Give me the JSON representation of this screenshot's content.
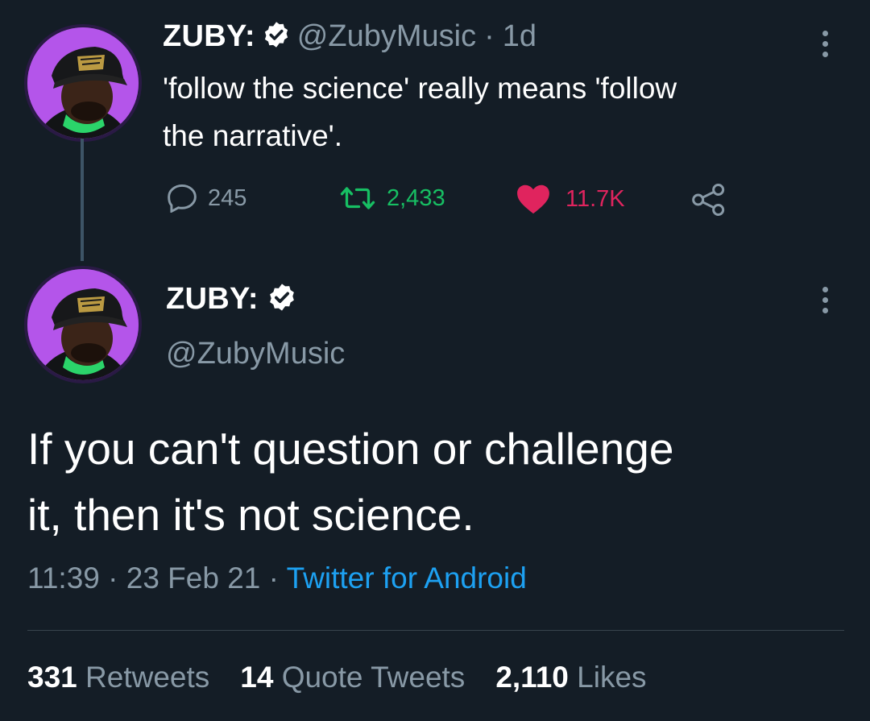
{
  "parent_tweet": {
    "display_name": "ZUBY:",
    "handle": "@ZubyMusic",
    "separator": "·",
    "time_ago": "1d",
    "text_line1": "'follow the science' really means 'follow",
    "text_line2": "the narrative'.",
    "replies": "245",
    "retweets": "2,433",
    "likes": "11.7K",
    "icons": [
      "reply-icon",
      "retweet-icon",
      "heart-icon",
      "share-icon",
      "more-icon",
      "verified-icon"
    ]
  },
  "main_tweet": {
    "display_name": "ZUBY:",
    "handle": "@ZubyMusic",
    "text_line1": "If you can't question or challenge",
    "text_line2": "it, then it's not science.",
    "time": "11:39",
    "date": "23 Feb 21",
    "separator": "·",
    "source": "Twitter for Android",
    "retweet_count": "331",
    "retweet_label": "Retweets",
    "quote_count": "14",
    "quote_label": "Quote Tweets",
    "like_count": "2,110",
    "like_label": "Likes"
  },
  "colors": {
    "background": "#141d26",
    "muted": "#8899a6",
    "retweet_green": "#17bf63",
    "like_red": "#e0245e",
    "link_blue": "#1da1f2",
    "avatar_purple": "#b24fe6"
  }
}
